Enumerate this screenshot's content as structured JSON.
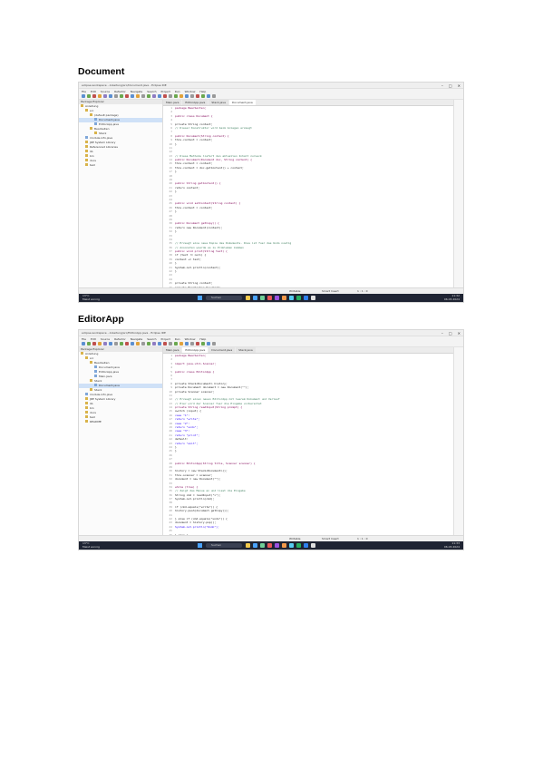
{
  "sections": [
    {
      "heading": "Document",
      "window_title": "eclipse-workspace - Anleitung/src/Document.java - Eclipse IDE",
      "menu": [
        "File",
        "Edit",
        "Source",
        "Refactor",
        "Navigate",
        "Search",
        "Project",
        "Run",
        "Window",
        "Help"
      ],
      "explorer_header": "Package Explorer",
      "tree": [
        {
          "label": "Anleitung",
          "indent": 0
        },
        {
          "label": "src",
          "indent": 1
        },
        {
          "label": "(default package)",
          "indent": 2
        },
        {
          "label": "Document.java",
          "indent": 3,
          "selected": true
        },
        {
          "label": "EditorApp.java",
          "indent": 3
        },
        {
          "label": "Bearbeiten",
          "indent": 2
        },
        {
          "label": "Stack",
          "indent": 3
        },
        {
          "label": "module-info.java",
          "indent": 1
        },
        {
          "label": "JRE System Library",
          "indent": 1
        },
        {
          "label": "Referenced Libraries",
          "indent": 1
        },
        {
          "label": "lib",
          "indent": 1
        },
        {
          "label": "bin",
          "indent": 1
        },
        {
          "label": "docs",
          "indent": 1
        },
        {
          "label": "test",
          "indent": 1
        }
      ],
      "tabs": [
        {
          "label": "Main.java",
          "active": false
        },
        {
          "label": "EditorApp.java",
          "active": false
        },
        {
          "label": "Stack.java",
          "active": false
        },
        {
          "label": "Document.java",
          "active": true
        }
      ],
      "code": [
        {
          "n": "1",
          "t": "package Bearbeiten;",
          "k": "kw"
        },
        {
          "n": "2",
          "t": "",
          "k": ""
        },
        {
          "n": "3",
          "t": "public class Document {",
          "k": "kw"
        },
        {
          "n": "4",
          "t": "",
          "k": ""
        },
        {
          "n": "5",
          "t": "    private String content;",
          "k": ""
        },
        {
          "n": "6",
          "t": "    // Dieser Konstruktor wird beim Anlegen erzeugt",
          "k": "cm"
        },
        {
          "n": "7",
          "t": "",
          "k": ""
        },
        {
          "n": "8",
          "t": "    public Document(String content) {",
          "k": "kw"
        },
        {
          "n": "9",
          "t": "        this.content = content;",
          "k": ""
        },
        {
          "n": "10",
          "t": "    }",
          "k": ""
        },
        {
          "n": "11",
          "t": "",
          "k": ""
        },
        {
          "n": "12",
          "t": "",
          "k": ""
        },
        {
          "n": "13",
          "t": "    // Diese Methode liefert den aktuellen Inhalt zurueck",
          "k": "cm"
        },
        {
          "n": "14",
          "t": "    public Document(Document doc, String content) {",
          "k": "kw"
        },
        {
          "n": "15",
          "t": "        this.content = content;",
          "k": ""
        },
        {
          "n": "16",
          "t": "        this.content = doc.getContent() + content;",
          "k": ""
        },
        {
          "n": "17",
          "t": "    }",
          "k": ""
        },
        {
          "n": "18",
          "t": "",
          "k": ""
        },
        {
          "n": "19",
          "t": "",
          "k": ""
        },
        {
          "n": "20",
          "t": "    public String getContent() {",
          "k": "kw"
        },
        {
          "n": "21",
          "t": "        return content;",
          "k": ""
        },
        {
          "n": "22",
          "t": "    }",
          "k": ""
        },
        {
          "n": "23",
          "t": "",
          "k": ""
        },
        {
          "n": "24",
          "t": "",
          "k": ""
        },
        {
          "n": "25",
          "t": "    public void setContent(String content) {",
          "k": "kw"
        },
        {
          "n": "26",
          "t": "        this.content = content;",
          "k": ""
        },
        {
          "n": "27",
          "t": "    }",
          "k": ""
        },
        {
          "n": "28",
          "t": "",
          "k": ""
        },
        {
          "n": "29",
          "t": "",
          "k": ""
        },
        {
          "n": "30",
          "t": "    public Document getCopy() {",
          "k": "kw"
        },
        {
          "n": "31",
          "t": "        return new Document(content);",
          "k": ""
        },
        {
          "n": "32",
          "t": "    }",
          "k": ""
        },
        {
          "n": "33",
          "t": "",
          "k": ""
        },
        {
          "n": "34",
          "t": "",
          "k": ""
        },
        {
          "n": "35",
          "t": "    // Erzeugt eine neue Kopie des Dokuments. Dies ist fuer das Undo noetig",
          "k": "cm"
        },
        {
          "n": "36",
          "t": "    // Ansonsten wuerde es zu Problemen kommen",
          "k": "cm"
        },
        {
          "n": "37",
          "t": "    public void print(String text) {",
          "k": "kw"
        },
        {
          "n": "38",
          "t": "        if (text != null) {",
          "k": ""
        },
        {
          "n": "39",
          "t": "            content += text;",
          "k": ""
        },
        {
          "n": "40",
          "t": "        }",
          "k": ""
        },
        {
          "n": "41",
          "t": "        System.out.println(content);",
          "k": ""
        },
        {
          "n": "42",
          "t": "    }",
          "k": ""
        },
        {
          "n": "43",
          "t": "",
          "k": ""
        },
        {
          "n": "44",
          "t": "",
          "k": ""
        },
        {
          "n": "45",
          "t": "    private String content;",
          "k": ""
        },
        {
          "n": "46",
          "t": "    private Bearbeiten.Document;",
          "k": ""
        }
      ],
      "status": [
        "Writable",
        "Smart Insert",
        "1 : 1 : 0"
      ],
      "taskbar": {
        "weather_temp": "13°C",
        "weather_desc": "Meist sonnig",
        "search": "Suchen",
        "time": "11:32",
        "date": "06.03.2024"
      }
    },
    {
      "heading": "EditorApp",
      "window_title": "eclipse-workspace - Anleitung/src/EditorApp.java - Eclipse IDE",
      "menu": [
        "File",
        "Edit",
        "Source",
        "Refactor",
        "Navigate",
        "Search",
        "Project",
        "Run",
        "Window",
        "Help"
      ],
      "explorer_header": "Package Explorer",
      "tree": [
        {
          "label": "Anleitung",
          "indent": 0
        },
        {
          "label": "src",
          "indent": 1
        },
        {
          "label": "Bearbeiten",
          "indent": 2
        },
        {
          "label": "Document.java",
          "indent": 3
        },
        {
          "label": "EditorApp.java",
          "indent": 3
        },
        {
          "label": "Main.java",
          "indent": 3
        },
        {
          "label": "Stack",
          "indent": 2
        },
        {
          "label": "Document.java",
          "indent": 3,
          "selected": true
        },
        {
          "label": "Stack",
          "indent": 2
        },
        {
          "label": "module-info.java",
          "indent": 1
        },
        {
          "label": "JRE System Library",
          "indent": 1
        },
        {
          "label": "lib",
          "indent": 1
        },
        {
          "label": "bin",
          "indent": 1
        },
        {
          "label": "docs",
          "indent": 1
        },
        {
          "label": "test",
          "indent": 1
        },
        {
          "label": "README",
          "indent": 1
        }
      ],
      "tabs": [
        {
          "label": "Main.java",
          "active": false
        },
        {
          "label": "EditorApp.java",
          "active": true
        },
        {
          "label": "Document.java",
          "active": false
        },
        {
          "label": "Stack.java",
          "active": false
        }
      ],
      "code": [
        {
          "n": "1",
          "t": "package Bearbeiten;",
          "k": "kw"
        },
        {
          "n": "2",
          "t": "",
          "k": ""
        },
        {
          "n": "3",
          "t": "import java.util.Scanner;",
          "k": "kw"
        },
        {
          "n": "4",
          "t": "",
          "k": ""
        },
        {
          "n": "5",
          "t": "public class EditorApp {",
          "k": "kw"
        },
        {
          "n": "6",
          "t": "",
          "k": ""
        },
        {
          "n": "7",
          "t": "",
          "k": ""
        },
        {
          "n": "8",
          "t": "    private Stack<Document> history;",
          "k": ""
        },
        {
          "n": "9",
          "t": "    private Document document = new Document(\"\");",
          "k": ""
        },
        {
          "n": "10",
          "t": "    private Scanner scanner;",
          "k": ""
        },
        {
          "n": "11",
          "t": "",
          "k": ""
        },
        {
          "n": "12",
          "t": "    // Erzeugt einen neuen EditorApp mit leerem Dokument und Verlauf",
          "k": "cm"
        },
        {
          "n": "13",
          "t": "    // Hier wird der Scanner fuer die Eingabe vorbereitet",
          "k": "cm"
        },
        {
          "n": "14",
          "t": "    private String readInput(String prompt) {",
          "k": "kw"
        },
        {
          "n": "15",
          "t": "        switch (input) {",
          "k": ""
        },
        {
          "n": "16",
          "t": "            case \"1\":",
          "k": "st"
        },
        {
          "n": "17",
          "t": "                return \"write\";",
          "k": "st"
        },
        {
          "n": "18",
          "t": "            case \"2\":",
          "k": "st"
        },
        {
          "n": "19",
          "t": "                return \"undo\";",
          "k": "st"
        },
        {
          "n": "20",
          "t": "            case \"3\":",
          "k": "st"
        },
        {
          "n": "21",
          "t": "                return \"print\";",
          "k": "st"
        },
        {
          "n": "22",
          "t": "            default:",
          "k": ""
        },
        {
          "n": "23",
          "t": "                return \"exit\";",
          "k": "st"
        },
        {
          "n": "24",
          "t": "        }",
          "k": ""
        },
        {
          "n": "25",
          "t": "    }",
          "k": ""
        },
        {
          "n": "26",
          "t": "",
          "k": ""
        },
        {
          "n": "27",
          "t": "",
          "k": ""
        },
        {
          "n": "28",
          "t": "    public EditorApp(String title, Scanner scanner) {",
          "k": "kw"
        },
        {
          "n": "29",
          "t": "",
          "k": ""
        },
        {
          "n": "30",
          "t": "        history = new Stack<Document>();",
          "k": ""
        },
        {
          "n": "31",
          "t": "        this.scanner = scanner;",
          "k": ""
        },
        {
          "n": "32",
          "t": "        document = new Document(\"\");",
          "k": ""
        },
        {
          "n": "33",
          "t": "",
          "k": ""
        },
        {
          "n": "34",
          "t": "        while (true) {",
          "k": "kw"
        },
        {
          "n": "35",
          "t": "            // Zeigt das Menue an und liest die Eingabe",
          "k": "cm"
        },
        {
          "n": "36",
          "t": "            String cmd = readInput(\">\");",
          "k": ""
        },
        {
          "n": "37",
          "t": "                System.out.println(cmd);",
          "k": ""
        },
        {
          "n": "38",
          "t": "",
          "k": ""
        },
        {
          "n": "39",
          "t": "            if (cmd.equals(\"write\")) {",
          "k": ""
        },
        {
          "n": "40",
          "t": "                history.push(document.getCopy());",
          "k": ""
        },
        {
          "n": "41",
          "t": "",
          "k": ""
        },
        {
          "n": "42",
          "t": "            } else if (cmd.equals(\"undo\")) {",
          "k": ""
        },
        {
          "n": "43",
          "t": "                document = history.pop();",
          "k": ""
        },
        {
          "n": "44",
          "t": "                System.out.println(\"Undo\");",
          "k": "st"
        },
        {
          "n": "45",
          "t": "",
          "k": ""
        },
        {
          "n": "46",
          "t": "            } else {",
          "k": ""
        },
        {
          "n": "47",
          "t": "                document.print(null);",
          "k": ""
        }
      ],
      "status": [
        "Writable",
        "Smart Insert",
        "1 : 1 : 0"
      ],
      "taskbar": {
        "weather_temp": "13°C",
        "weather_desc": "Meist sonnig",
        "search": "Suchen",
        "time": "11:33",
        "date": "06.03.2024"
      }
    }
  ],
  "colors": {
    "taskbar": "#1f2433",
    "selection": "#cfe1f7",
    "keyword": "#7f0055",
    "comment": "#3f7f5f",
    "string": "#2a00ff"
  },
  "icons": [
    "minimize-icon",
    "maximize-icon",
    "close-icon",
    "folder-icon",
    "java-file-icon",
    "search-icon",
    "windows-start-icon"
  ]
}
